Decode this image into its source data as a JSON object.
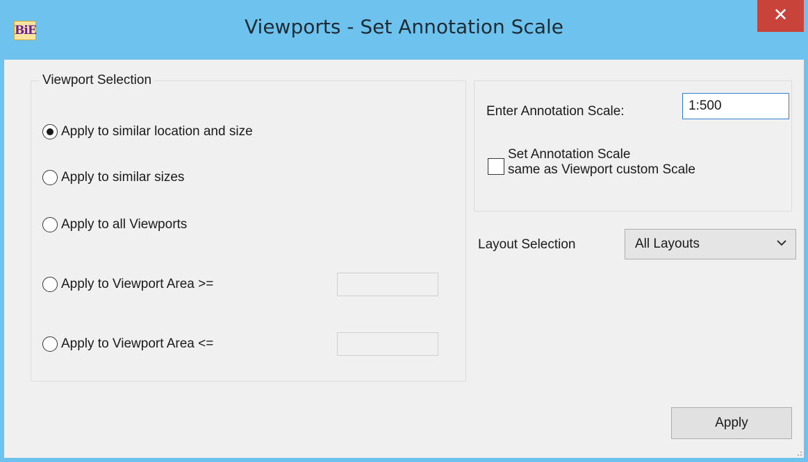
{
  "window": {
    "title": "Viewports - Set Annotation Scale",
    "icon_text": "BiE",
    "close_glyph": "✕",
    "accent_color": "#6ec3ee",
    "close_color": "#c8443b"
  },
  "viewport_selection": {
    "legend": "Viewport Selection",
    "options": [
      {
        "label": "Apply to similar location and  size",
        "checked": true
      },
      {
        "label": "Apply to similar sizes",
        "checked": false
      },
      {
        "label": "Apply to all Viewports",
        "checked": false
      },
      {
        "label": "Apply to Viewport Area >=",
        "checked": false
      },
      {
        "label": "Apply to Viewport Area <=",
        "checked": false
      }
    ],
    "area_min_value": "",
    "area_max_value": ""
  },
  "annotation": {
    "label": "Enter Annotation Scale:",
    "value": "1:500",
    "checkbox_label_line1": "Set Annotation Scale",
    "checkbox_label_line2": "same as Viewport custom Scale",
    "checkbox_checked": false
  },
  "layout": {
    "label": "Layout Selection",
    "selected": "All Layouts",
    "chevron_icon": "chevron-down-icon"
  },
  "buttons": {
    "apply": "Apply"
  }
}
